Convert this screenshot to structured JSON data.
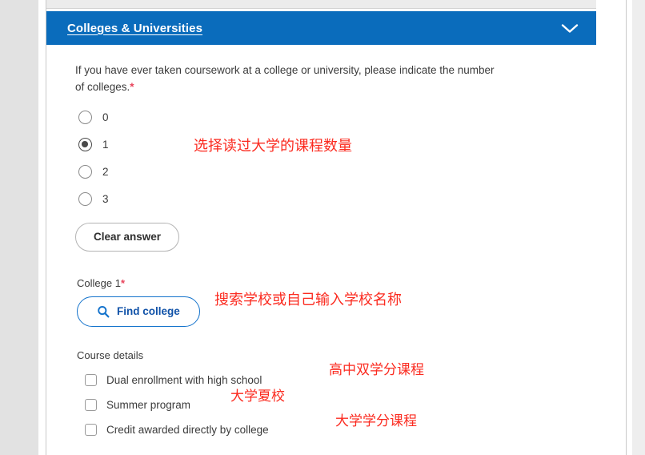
{
  "section": {
    "title": "Colleges & Universities",
    "collapse_icon": "chevron-down-icon"
  },
  "question": {
    "text": "If you have ever taken coursework at a college or university, please indicate the number of colleges.",
    "required_marker": "*",
    "options": [
      {
        "label": "0",
        "selected": false
      },
      {
        "label": "1",
        "selected": true
      },
      {
        "label": "2",
        "selected": false
      },
      {
        "label": "3",
        "selected": false
      }
    ],
    "clear_label": "Clear answer"
  },
  "college": {
    "label": "College 1",
    "required_marker": "*",
    "find_button_label": "Find college",
    "find_button_icon": "search-icon"
  },
  "course_details": {
    "label": "Course details",
    "checkboxes": [
      {
        "label": "Dual enrollment with high school",
        "checked": false
      },
      {
        "label": "Summer program",
        "checked": false
      },
      {
        "label": "Credit awarded directly by college",
        "checked": false
      }
    ]
  },
  "annotations": {
    "radios": "选择读过大学的课程数量",
    "find_college": "搜索学校或自己输入学校名称",
    "dual_enrollment": "高中双学分课程",
    "summer_program": "大学夏校",
    "credit_awarded": "大学学分课程"
  },
  "colors": {
    "header_blue": "#0a6cbc",
    "link_blue": "#1052a8",
    "annotation_red": "#fb2b20",
    "required_red": "#e8425a",
    "page_background": "#e2e2e2"
  }
}
